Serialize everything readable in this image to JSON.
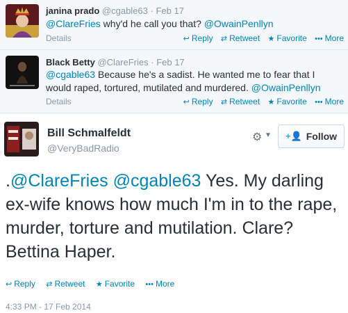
{
  "tweets": [
    {
      "name": "janina prado",
      "handle": "@cgable63",
      "date": "Feb 17",
      "text_parts": {
        "m1": "@ClareFries",
        "t1": " why'd he call you that? ",
        "m2": "@OwainPenllyn"
      },
      "details_label": "Details"
    },
    {
      "name": "Black Betty",
      "handle": "@ClareFries",
      "date": "Feb 17",
      "text_parts": {
        "m1": "@cgable63",
        "t1": " Because he's a sadist. He wanted me to fear that I would raped, tortured, mutilated and murdered. ",
        "m2": "@OwainPenllyn"
      },
      "details_label": "Details"
    }
  ],
  "actions": {
    "reply": "Reply",
    "retweet": "Retweet",
    "favorite": "Favorite",
    "more": "More"
  },
  "main_tweet": {
    "name": "Bill Schmalfeldt",
    "handle": "@VeryBadRadio",
    "follow_label": "Follow",
    "text_prefix": ".",
    "mention1": "@ClareFries",
    "mention2": "@cgable63",
    "text_body": " Yes. My darling ex-wife knows how much I'm in to the rape, murder, torture and mutilation. Clare? Bettina Haper.",
    "timestamp": "4:33 PM - 17 Feb 2014"
  },
  "icons": {
    "reply": "reply-arrow-icon",
    "retweet": "retweet-icon",
    "favorite": "star-icon",
    "more": "ellipsis-icon",
    "settings": "gear-icon",
    "follow": "add-user-icon"
  }
}
